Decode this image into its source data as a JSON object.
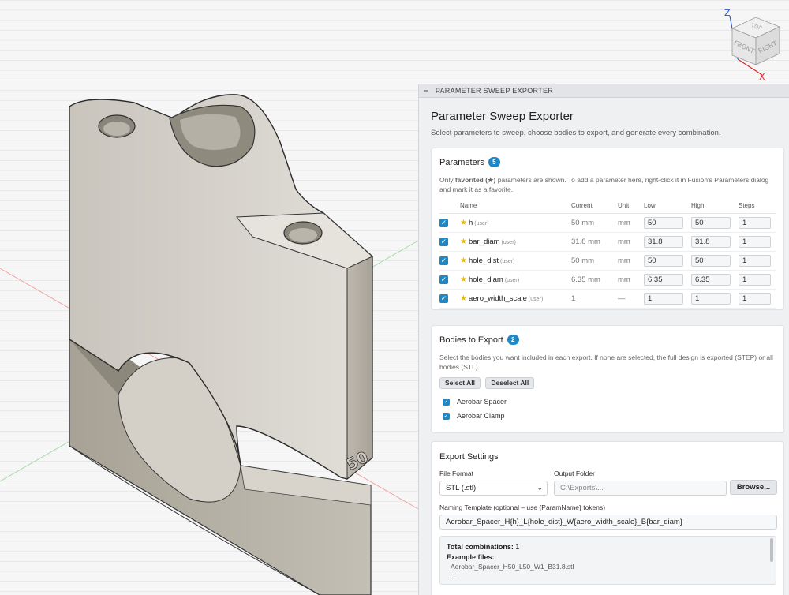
{
  "viewcube": {
    "axis_z": "Z",
    "axis_x": "X",
    "face_top": "TOP",
    "face_front": "FRONT",
    "face_right": "RIGHT"
  },
  "model": {
    "engraving": "50"
  },
  "panel": {
    "header": "PARAMETER SWEEP EXPORTER",
    "collapse_glyph": "−",
    "title": "Parameter Sweep Exporter",
    "subtitle": "Select parameters to sweep, choose bodies to export, and generate every combination."
  },
  "parameters": {
    "heading": "Parameters",
    "count": "5",
    "note_pre": "Only ",
    "note_bold": "favorited (★)",
    "note_post": " parameters are shown. To add a parameter here, right-click it in Fusion's Parameters dialog and mark it as a favorite.",
    "columns": {
      "name": "Name",
      "current": "Current",
      "unit": "Unit",
      "low": "Low",
      "high": "High",
      "steps": "Steps"
    },
    "rows": [
      {
        "name": "h",
        "scope": "(user)",
        "current": "50 mm",
        "unit": "mm",
        "low": "50",
        "high": "50",
        "steps": "1"
      },
      {
        "name": "bar_diam",
        "scope": "(user)",
        "current": "31.8 mm",
        "unit": "mm",
        "low": "31.8",
        "high": "31.8",
        "steps": "1"
      },
      {
        "name": "hole_dist",
        "scope": "(user)",
        "current": "50 mm",
        "unit": "mm",
        "low": "50",
        "high": "50",
        "steps": "1"
      },
      {
        "name": "hole_diam",
        "scope": "(user)",
        "current": "6.35 mm",
        "unit": "mm",
        "low": "6.35",
        "high": "6.35",
        "steps": "1"
      },
      {
        "name": "aero_width_scale",
        "scope": "(user)",
        "current": "1",
        "unit": "—",
        "low": "1",
        "high": "1",
        "steps": "1"
      }
    ]
  },
  "bodies": {
    "heading": "Bodies to Export",
    "count": "2",
    "desc": "Select the bodies you want included in each export. If none are selected, the full design is exported (STEP) or all bodies (STL).",
    "select_all": "Select All",
    "deselect_all": "Deselect All",
    "items": [
      "Aerobar Spacer",
      "Aerobar Clamp"
    ]
  },
  "export": {
    "heading": "Export Settings",
    "format_label": "File Format",
    "format_value": "STL (.stl)",
    "folder_label": "Output Folder",
    "folder_placeholder": "C:\\Exports\\...",
    "browse": "Browse...",
    "template_label": "Naming Template (optional – use {ParamName} tokens)",
    "template_value": "Aerobar_Spacer_H{h}_L{hole_dist}_W{aero_width_scale}_B{bar_diam}",
    "total_label": "Total combinations:",
    "total_value": "1",
    "example_label": "Example files:",
    "example_file": "Aerobar_Spacer_H50_L50_W1_B31.8.stl",
    "more": "..."
  },
  "colors": {
    "accent": "#1e88c7",
    "star": "#f2b600",
    "model_face": "#d9d6cf",
    "axis_z": "#2b55d8",
    "axis_x": "#e02424"
  }
}
